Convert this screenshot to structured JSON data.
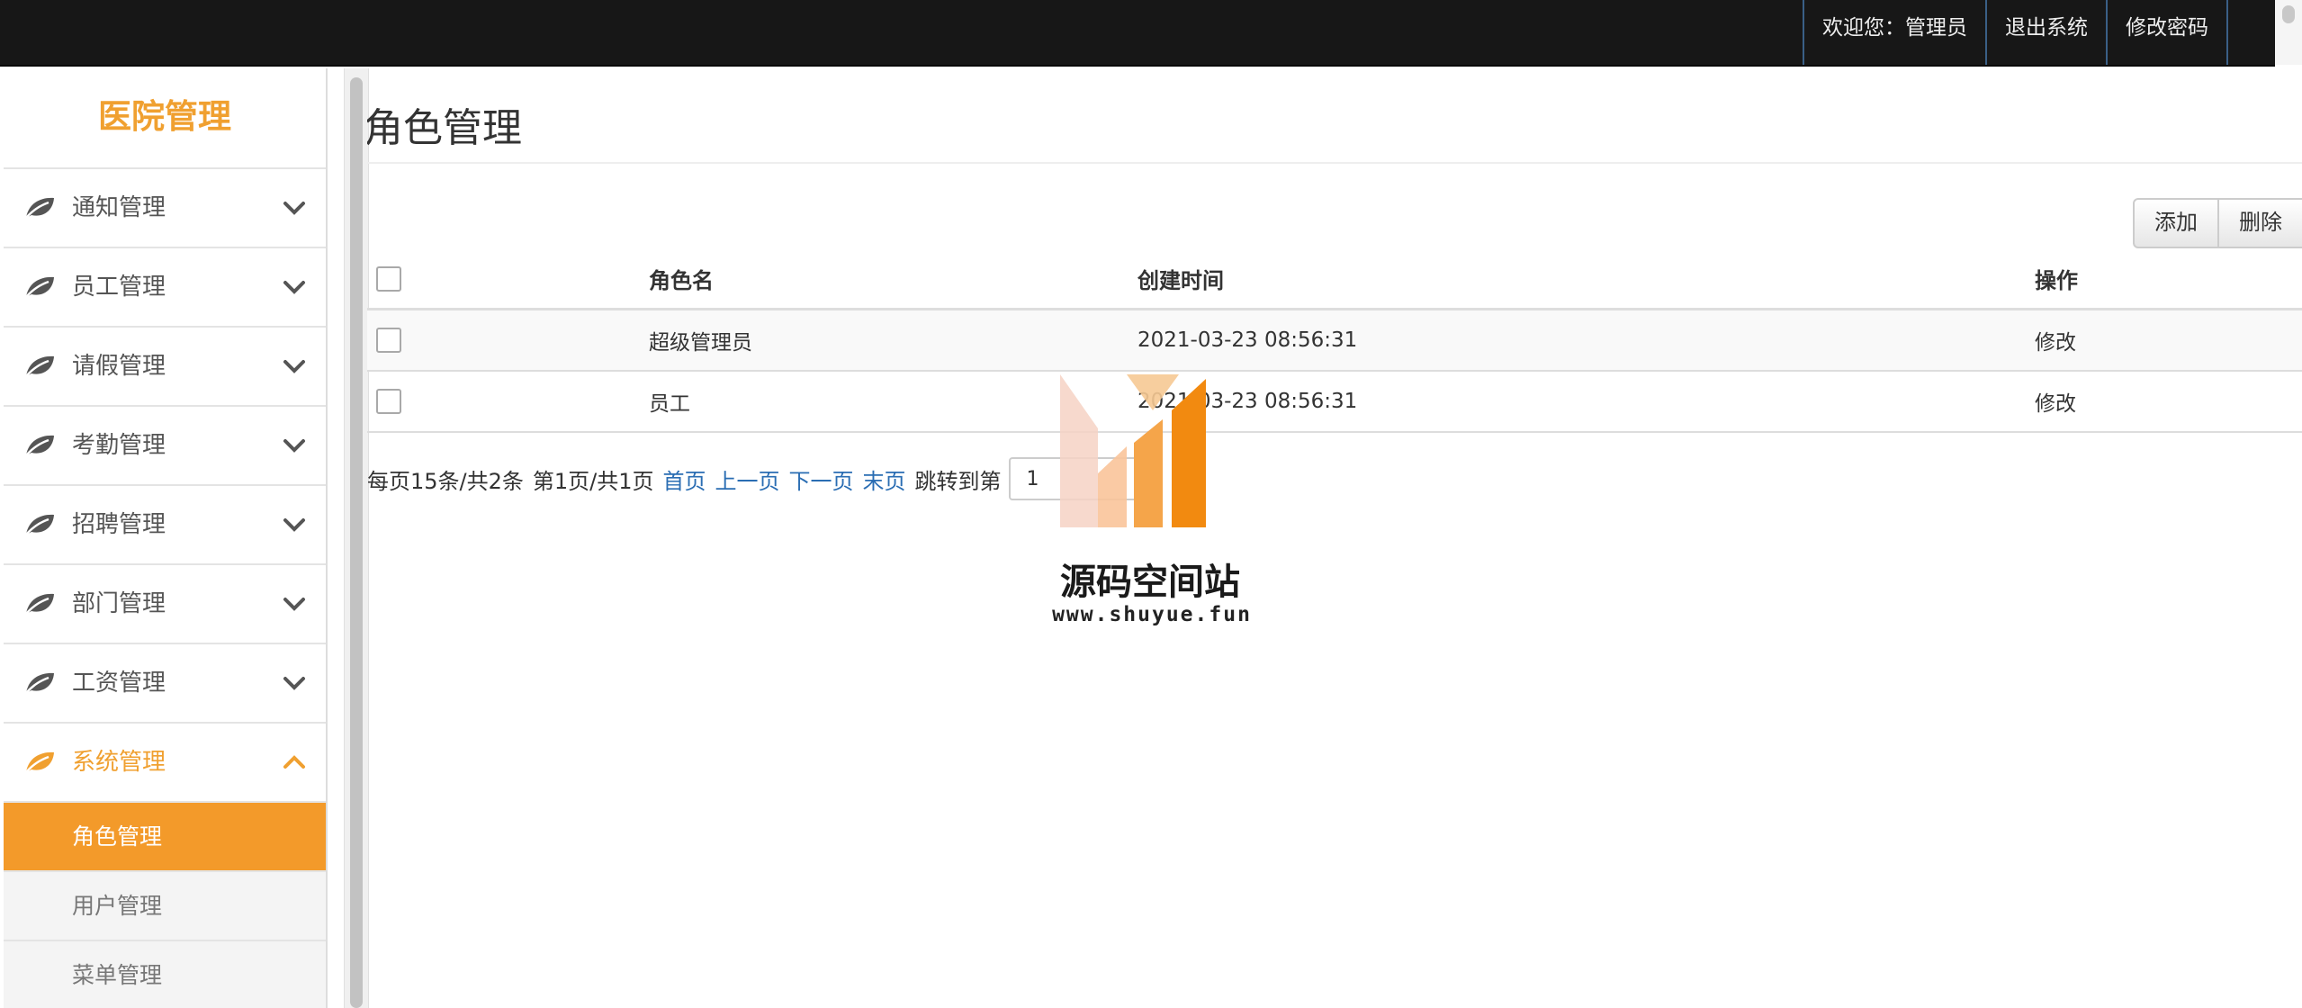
{
  "topbar": {
    "welcome": "欢迎您：管理员",
    "logout": "退出系统",
    "change_password": "修改密码"
  },
  "sidebar": {
    "brand": "医院管理",
    "menus": [
      {
        "label": "通知管理",
        "expanded": false
      },
      {
        "label": "员工管理",
        "expanded": false
      },
      {
        "label": "请假管理",
        "expanded": false
      },
      {
        "label": "考勤管理",
        "expanded": false
      },
      {
        "label": "招聘管理",
        "expanded": false
      },
      {
        "label": "部门管理",
        "expanded": false
      },
      {
        "label": "工资管理",
        "expanded": false
      },
      {
        "label": "系统管理",
        "expanded": true
      }
    ],
    "submenu": [
      {
        "label": "角色管理",
        "active": true
      },
      {
        "label": "用户管理",
        "active": false
      },
      {
        "label": "菜单管理",
        "active": false
      }
    ]
  },
  "main": {
    "title": "角色管理",
    "buttons": {
      "add": "添加",
      "delete": "删除"
    },
    "table": {
      "headers": {
        "name": "角色名",
        "created": "创建时间",
        "action": "操作"
      },
      "rows": [
        {
          "name": "超级管理员",
          "created": "2021-03-23 08:56:31",
          "action": "修改"
        },
        {
          "name": "员工",
          "created": "2021-03-23 08:56:31",
          "action": "修改"
        }
      ]
    },
    "pager": {
      "summary": "每页15条/共2条",
      "page_info": "第1页/共1页",
      "first": "首页",
      "prev": "上一页",
      "next": "下一页",
      "last": "末页",
      "jump_label": "跳转到第",
      "jump_value": "1"
    }
  },
  "watermark": {
    "name": "源码空间站",
    "url": "www.shuyue.fun"
  },
  "colors": {
    "accent": "#f39a2a",
    "brand_text": "#f0a030",
    "topbar": "#171717",
    "link": "#2a6db3"
  }
}
